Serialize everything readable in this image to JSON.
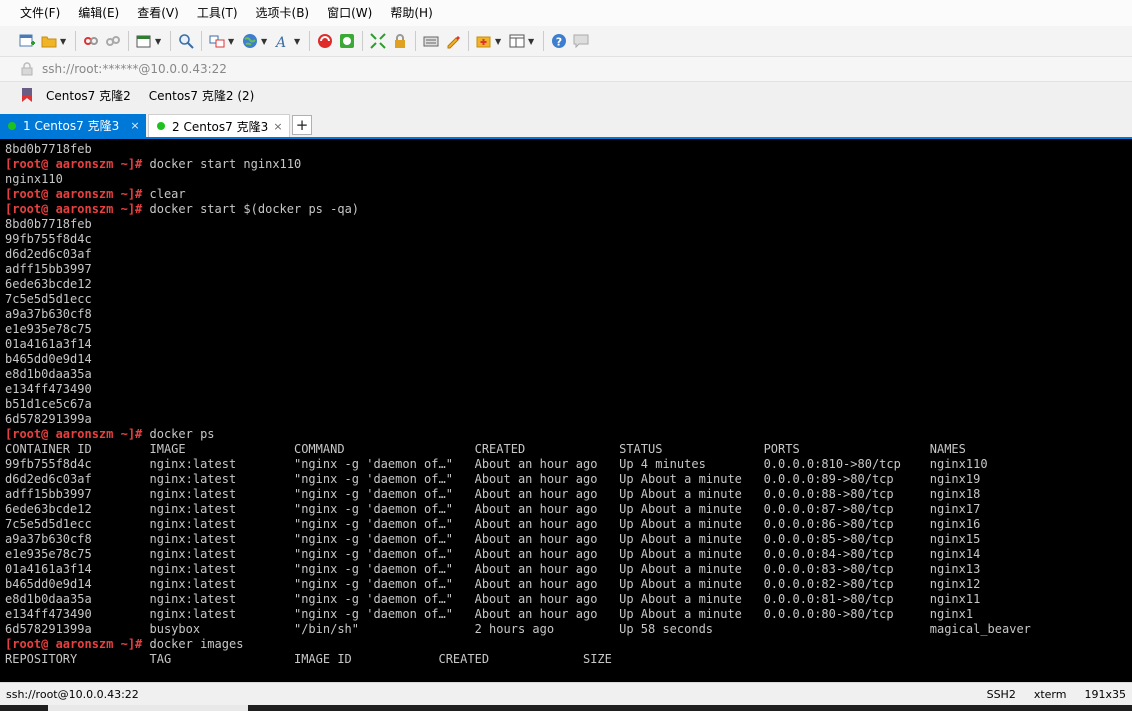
{
  "menu": [
    "文件(F)",
    "编辑(E)",
    "查看(V)",
    "工具(T)",
    "选项卡(B)",
    "窗口(W)",
    "帮助(H)"
  ],
  "toolbar_icons": [
    "new-session-icon",
    "open-folder-icon",
    "disconnect-icon",
    "reconnect-icon",
    "new-window-icon",
    "find-icon",
    "transfer-icon",
    "globe-icon",
    "font-icon",
    "xftp-icon",
    "xmanager-icon",
    "fullscreen-icon",
    "lock-icon",
    "keyboard-icon",
    "highlight-icon",
    "add-tab-icon",
    "layout-icon",
    "help-icon",
    "chat-icon"
  ],
  "address": {
    "text": "ssh://root:******@10.0.0.43:22"
  },
  "links": [
    {
      "label": "Centos7 克隆2"
    },
    {
      "label": "Centos7 克隆2 (2)"
    }
  ],
  "tabs": [
    {
      "label": "1 Centos7 克隆3",
      "active": true
    },
    {
      "label": "2 Centos7 克隆3",
      "active": false
    }
  ],
  "terminal": {
    "prompt": "[root@ aaronszm ~]#",
    "lines": [
      {
        "text": "8bd0b7718feb"
      },
      {
        "prompt": true,
        "text": " docker start nginx110"
      },
      {
        "text": "nginx110"
      },
      {
        "prompt": true,
        "text": " clear"
      },
      {
        "prompt": true,
        "text": " docker start $(docker ps -qa)"
      },
      {
        "text": "8bd0b7718feb"
      },
      {
        "text": "99fb755f8d4c"
      },
      {
        "text": "d6d2ed6c03af"
      },
      {
        "text": "adff15bb3997"
      },
      {
        "text": "6ede63bcde12"
      },
      {
        "text": "7c5e5d5d1ecc"
      },
      {
        "text": "a9a37b630cf8"
      },
      {
        "text": "e1e935e78c75"
      },
      {
        "text": "01a4161a3f14"
      },
      {
        "text": "b465dd0e9d14"
      },
      {
        "text": "e8d1b0daa35a"
      },
      {
        "text": "e134ff473490"
      },
      {
        "text": "b51d1ce5c67a"
      },
      {
        "text": "6d578291399a"
      },
      {
        "prompt": true,
        "text": " docker ps"
      },
      {
        "text": "CONTAINER ID        IMAGE               COMMAND                  CREATED             STATUS              PORTS                  NAMES"
      },
      {
        "text": "99fb755f8d4c        nginx:latest        \"nginx -g 'daemon of…\"   About an hour ago   Up 4 minutes        0.0.0.0:810->80/tcp    nginx110"
      },
      {
        "text": "d6d2ed6c03af        nginx:latest        \"nginx -g 'daemon of…\"   About an hour ago   Up About a minute   0.0.0.0:89->80/tcp     nginx19"
      },
      {
        "text": "adff15bb3997        nginx:latest        \"nginx -g 'daemon of…\"   About an hour ago   Up About a minute   0.0.0.0:88->80/tcp     nginx18"
      },
      {
        "text": "6ede63bcde12        nginx:latest        \"nginx -g 'daemon of…\"   About an hour ago   Up About a minute   0.0.0.0:87->80/tcp     nginx17"
      },
      {
        "text": "7c5e5d5d1ecc        nginx:latest        \"nginx -g 'daemon of…\"   About an hour ago   Up About a minute   0.0.0.0:86->80/tcp     nginx16"
      },
      {
        "text": "a9a37b630cf8        nginx:latest        \"nginx -g 'daemon of…\"   About an hour ago   Up About a minute   0.0.0.0:85->80/tcp     nginx15"
      },
      {
        "text": "e1e935e78c75        nginx:latest        \"nginx -g 'daemon of…\"   About an hour ago   Up About a minute   0.0.0.0:84->80/tcp     nginx14"
      },
      {
        "text": "01a4161a3f14        nginx:latest        \"nginx -g 'daemon of…\"   About an hour ago   Up About a minute   0.0.0.0:83->80/tcp     nginx13"
      },
      {
        "text": "b465dd0e9d14        nginx:latest        \"nginx -g 'daemon of…\"   About an hour ago   Up About a minute   0.0.0.0:82->80/tcp     nginx12"
      },
      {
        "text": "e8d1b0daa35a        nginx:latest        \"nginx -g 'daemon of…\"   About an hour ago   Up About a minute   0.0.0.0:81->80/tcp     nginx11"
      },
      {
        "text": "e134ff473490        nginx:latest        \"nginx -g 'daemon of…\"   About an hour ago   Up About a minute   0.0.0.0:80->80/tcp     nginx1"
      },
      {
        "text": "6d578291399a        busybox             \"/bin/sh\"                2 hours ago         Up 58 seconds                              magical_beaver"
      },
      {
        "prompt": true,
        "text": " docker images"
      },
      {
        "text": "REPOSITORY          TAG                 IMAGE ID            CREATED             SIZE"
      }
    ]
  },
  "status": {
    "path": "ssh://root@10.0.0.43:22",
    "protocol": "SSH2",
    "terminal_type": "xterm",
    "size": "191x35"
  },
  "colors": {
    "prompt": "#e84040",
    "terminal_bg": "#000000",
    "terminal_fg": "#c7c7c7",
    "accent": "#0078d7",
    "tab_dot": "#1ec21e"
  }
}
